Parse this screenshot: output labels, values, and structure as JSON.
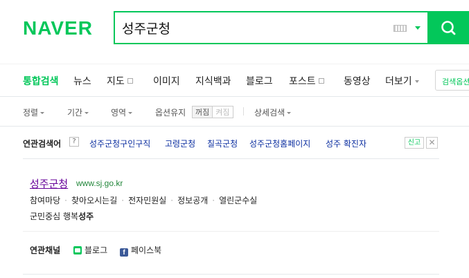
{
  "header": {
    "logo": "NAVER",
    "search_value": "성주군청"
  },
  "tabs": [
    {
      "label": "통합검색",
      "active": true
    },
    {
      "label": "뉴스"
    },
    {
      "label": "지도"
    },
    {
      "label": "이미지"
    },
    {
      "label": "지식백과"
    },
    {
      "label": "블로그"
    },
    {
      "label": "포스트"
    },
    {
      "label": "동영상"
    },
    {
      "label": "더보기"
    }
  ],
  "search_options_button": "검색옵션",
  "filters": {
    "sort": "정렬",
    "period": "기간",
    "area": "영역",
    "option_keep": "옵션유지",
    "toggle_off": "꺼짐",
    "toggle_on": "켜짐",
    "detail": "상세검색"
  },
  "related": {
    "title": "연관검색어",
    "help": "?",
    "items": [
      "성주군청구인구직",
      "고령군청",
      "칠곡군청",
      "성주군청홈페이지",
      "성주 확진자"
    ],
    "report": "신고",
    "close": "✕"
  },
  "result": {
    "title": "성주군청",
    "url": "www.sj.go.kr",
    "sublinks": [
      "참여마당",
      "찾아오시는길",
      "전자민원실",
      "정보공개",
      "열린군수실"
    ],
    "slogan_prefix": "군민중심 행복",
    "slogan_bold": "성주"
  },
  "channels": {
    "title": "연관채널",
    "items": [
      {
        "label": "블로그",
        "icon": "blog-icon"
      },
      {
        "label": "페이스북",
        "icon": "facebook-icon"
      }
    ]
  },
  "colors": {
    "brand": "#03c75a",
    "link": "#0b2ea0",
    "visited": "#660099",
    "url": "#22863a"
  }
}
